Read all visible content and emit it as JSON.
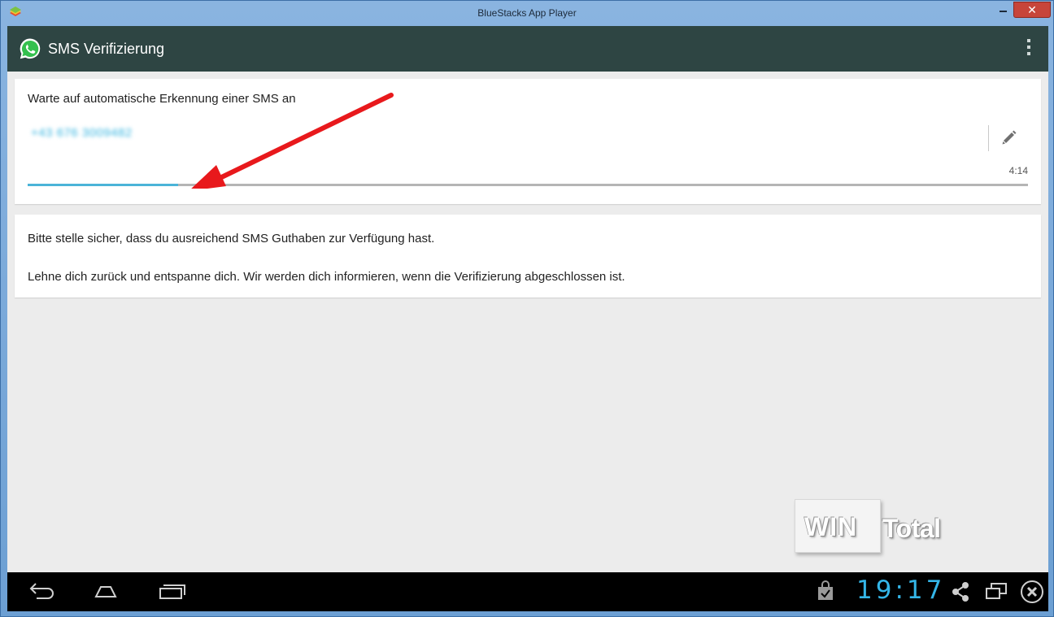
{
  "window": {
    "title": "BlueStacks App Player",
    "close_glyph": "✕"
  },
  "actionbar": {
    "title": "SMS Verifizierung"
  },
  "verification": {
    "wait_label": "Warte auf automatische Erkennung einer SMS an",
    "phone_number": "+43 676 3009482",
    "timer": "4:14",
    "progress": 0.15
  },
  "info": {
    "line1": "Bitte stelle sicher, dass du ausreichend SMS Guthaben zur Verfügung hast.",
    "line2": "Lehne dich zurück und entspanne dich. Wir werden dich informieren, wenn die Verifizierung abgeschlossen ist."
  },
  "watermark": {
    "part1": "WIN",
    "part2": "Total"
  },
  "navbar": {
    "clock": "19:17",
    "icons": [
      "back-icon",
      "home-icon",
      "recent-apps-icon",
      "store-bag-icon",
      "share-icon",
      "window-icon",
      "close-circle-icon"
    ]
  },
  "colors": {
    "actionbar": "#2e4543",
    "accent": "#4bb4d8",
    "clock": "#34b6e8",
    "annotation_arrow": "#e8191c"
  }
}
